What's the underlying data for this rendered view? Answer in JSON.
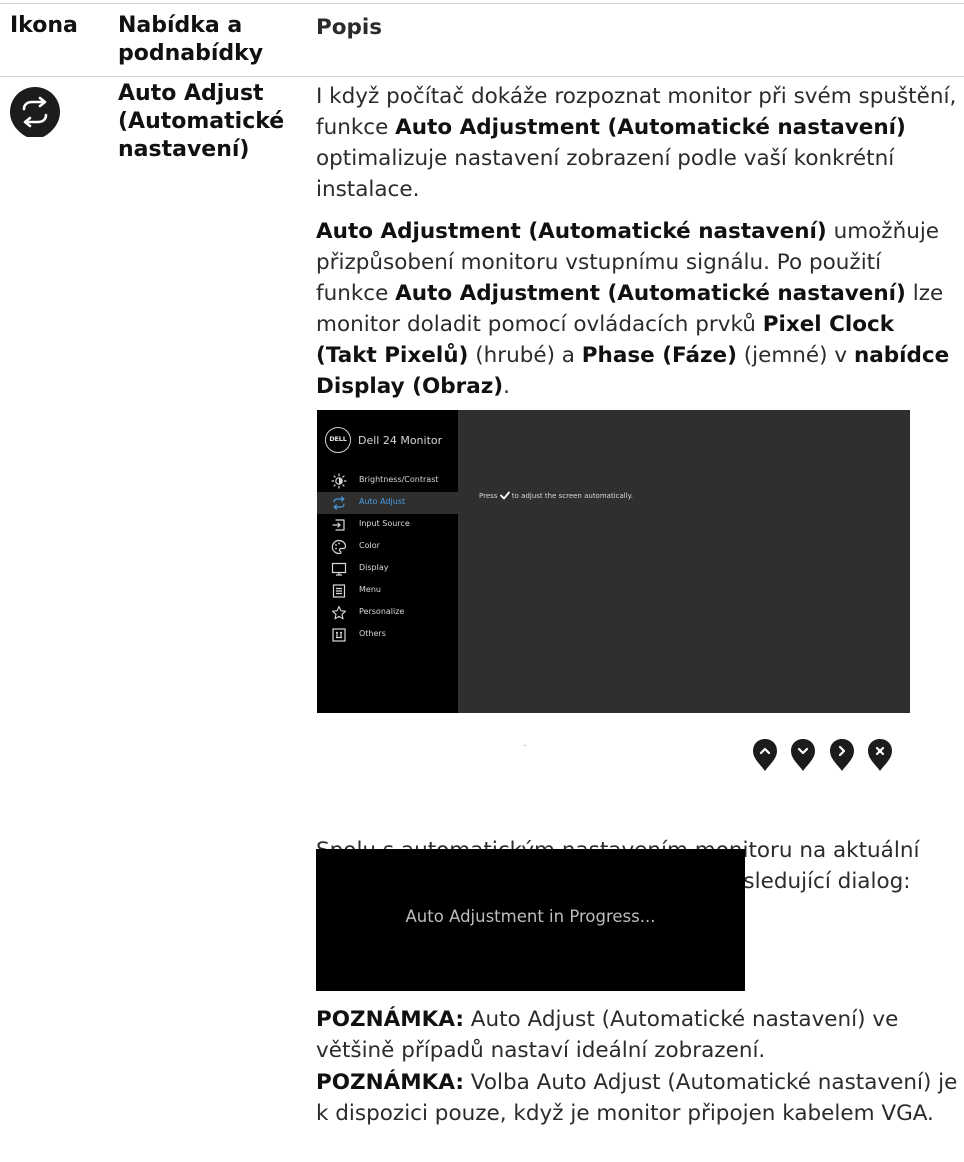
{
  "header": {
    "icon": "Ikona",
    "menu": "Nabídka a podnabídky",
    "description": "Popis"
  },
  "row": {
    "icon_name": "auto-adjust-icon",
    "menu_name": "Auto Adjust (Automatické nastavení)",
    "p1": {
      "a": "I když počítač dokáže rozpoznat monitor při svém spuštění, funkce ",
      "b": "Auto Adjustment (Automatické nastavení)",
      "c": " optimalizuje nastavení zobrazení podle vaší konkrétní instalace."
    },
    "p2": {
      "b1": "Auto Adjustment (Automatické nastavení)",
      "t1": " umožňuje přizpůsobení monitoru vstupnímu signálu. Po použití funkce ",
      "b2": "Auto Adjustment (Automatické nastavení)",
      "t2": " lze monitor doladit pomocí ovládacích prvků ",
      "b3": "Pixel Clock (Takt Pixelů)",
      "t3": " (hrubé) a ",
      "b4": "Phase (Fáze)",
      "t4": " (jemné) v ",
      "b5": "nabídce Display (Obraz)",
      "t5": "."
    },
    "p3": "Spolu s automatickým nastavením monitoru na aktuální vstup se na černé obrazovce zobrazí následující dialog:",
    "note1": {
      "label": "POZNÁMKA:",
      "text": " Auto Adjust (Automatické nastavení) ve většině případů nastaví ideální zobrazení."
    },
    "note2": {
      "label": "POZNÁMKA:",
      "text": " Volba Auto Adjust (Automatické nastavení) je k dispozici pouze, když je monitor připojen kabelem VGA."
    }
  },
  "osd": {
    "logo": "DELL",
    "title": "Dell 24 Monitor",
    "items": [
      {
        "label": "Brightness/Contrast",
        "icon": "brightness-icon"
      },
      {
        "label": "Auto Adjust",
        "icon": "auto-adjust-icon",
        "selected": true
      },
      {
        "label": "Input Source",
        "icon": "input-source-icon"
      },
      {
        "label": "Color",
        "icon": "color-icon"
      },
      {
        "label": "Display",
        "icon": "display-icon"
      },
      {
        "label": "Menu",
        "icon": "menu-icon"
      },
      {
        "label": "Personalize",
        "icon": "star-icon"
      },
      {
        "label": "Others",
        "icon": "others-icon"
      }
    ],
    "message_before": "Press",
    "message_after": " to adjust the screen automatically.",
    "selected_color": "#4a9be0",
    "panel_color": "#2f2f2f",
    "sidebar_color": "#000000"
  },
  "nav_buttons": [
    "chevron-up-icon",
    "chevron-down-icon",
    "chevron-right-icon",
    "close-icon"
  ],
  "dialog": {
    "text": "Auto Adjustment in Progress..."
  }
}
